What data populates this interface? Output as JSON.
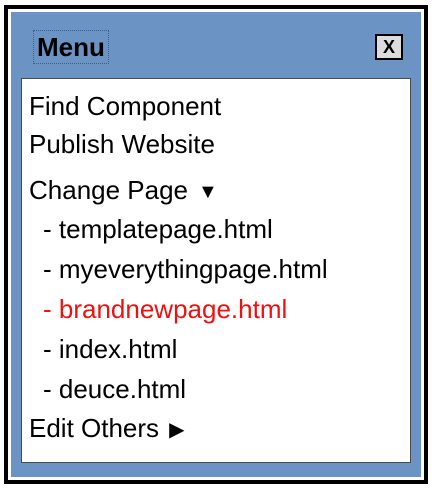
{
  "window": {
    "title": "Menu",
    "close_label": "X"
  },
  "menu": {
    "find_component": "Find Component",
    "publish_website": "Publish Website",
    "change_page": {
      "label": "Change Page",
      "indicator_icon": "triangle-down-icon",
      "pages": [
        {
          "label": "- templatepage.html"
        },
        {
          "label": "- myeverythingpage.html"
        },
        {
          "label": "- brandnewpage.html",
          "current": true
        },
        {
          "label": "- index.html"
        },
        {
          "label": "- deuce.html"
        }
      ]
    },
    "edit_others": {
      "label": "Edit Others",
      "indicator_icon": "triangle-right-icon"
    }
  },
  "colors": {
    "panel_background": "#6b94c4",
    "current_page": "#ee1111",
    "content_background": "#ffffff"
  }
}
